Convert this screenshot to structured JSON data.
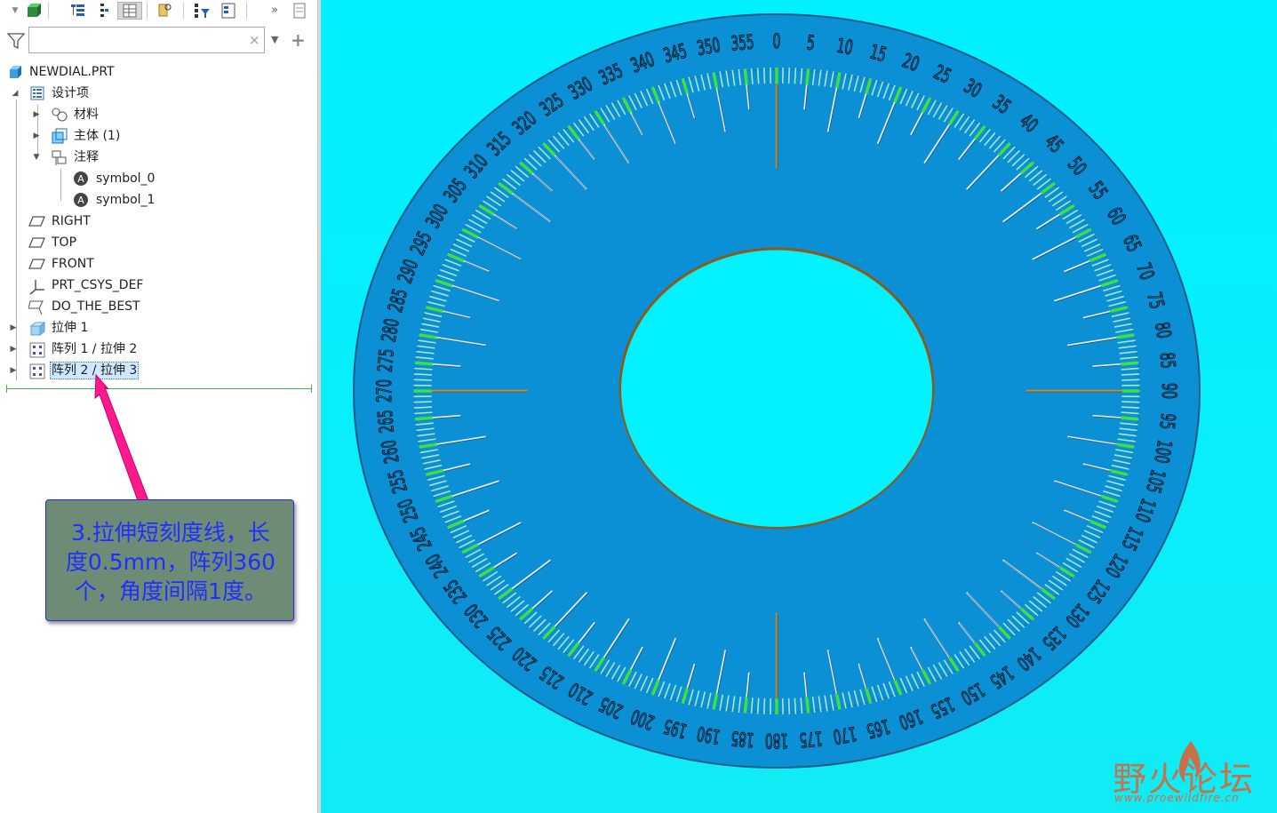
{
  "toolbar": {
    "buttons": [
      "model-tree-icon",
      "expand-tree-icon",
      "show-hierarchy-icon",
      "layer-tree-icon",
      "find-icon",
      "tree-filter-icon",
      "tree-columns-icon",
      "more-icon",
      "notes-icon"
    ]
  },
  "search": {
    "value": "",
    "placeholder": "",
    "clear_glyph": "×",
    "add_glyph": "+"
  },
  "tree": {
    "root": "NEWDIAL.PRT",
    "design_items": "设计项",
    "material": "材料",
    "body": "主体 (1)",
    "annotations": "注释",
    "symbol_0": "symbol_0",
    "symbol_1": "symbol_1",
    "right": "RIGHT",
    "top": "TOP",
    "front": "FRONT",
    "csys": "PRT_CSYS_DEF",
    "do_the_best": "DO_THE_BEST",
    "extrude1": "拉伸 1",
    "pattern1": "阵列 1 / 拉伸 2",
    "pattern2": "阵列 2 / 拉伸 3"
  },
  "callout": {
    "line1": "3.拉伸短刻度线，长",
    "line2": "度0.5mm，阵列360",
    "line3": "个，角度间隔1度。"
  },
  "dial": {
    "labels": [
      "0",
      "5",
      "10",
      "15",
      "20",
      "25",
      "30",
      "35",
      "40",
      "45",
      "50",
      "55",
      "60",
      "65",
      "70",
      "75",
      "80",
      "85",
      "90",
      "95",
      "100",
      "105",
      "110",
      "115",
      "120",
      "125",
      "130",
      "135",
      "140",
      "145",
      "150",
      "155",
      "160",
      "165",
      "170",
      "175",
      "180",
      "185",
      "190",
      "195",
      "200",
      "205",
      "210",
      "215",
      "220",
      "225",
      "230",
      "235",
      "240",
      "245",
      "250",
      "255",
      "260",
      "265",
      "270",
      "275",
      "280",
      "285",
      "290",
      "295",
      "300",
      "305",
      "310",
      "315",
      "320",
      "325",
      "330",
      "335",
      "340",
      "345",
      "350",
      "355"
    ],
    "colors": {
      "disk": "#0a8fd6",
      "ring": "#3fe03f",
      "text": "#0b1420",
      "accent": "#c98a2a",
      "background": "#00f0ff"
    }
  },
  "watermark": {
    "brand": "野火论坛",
    "url": "www.proewildfire.cn"
  }
}
